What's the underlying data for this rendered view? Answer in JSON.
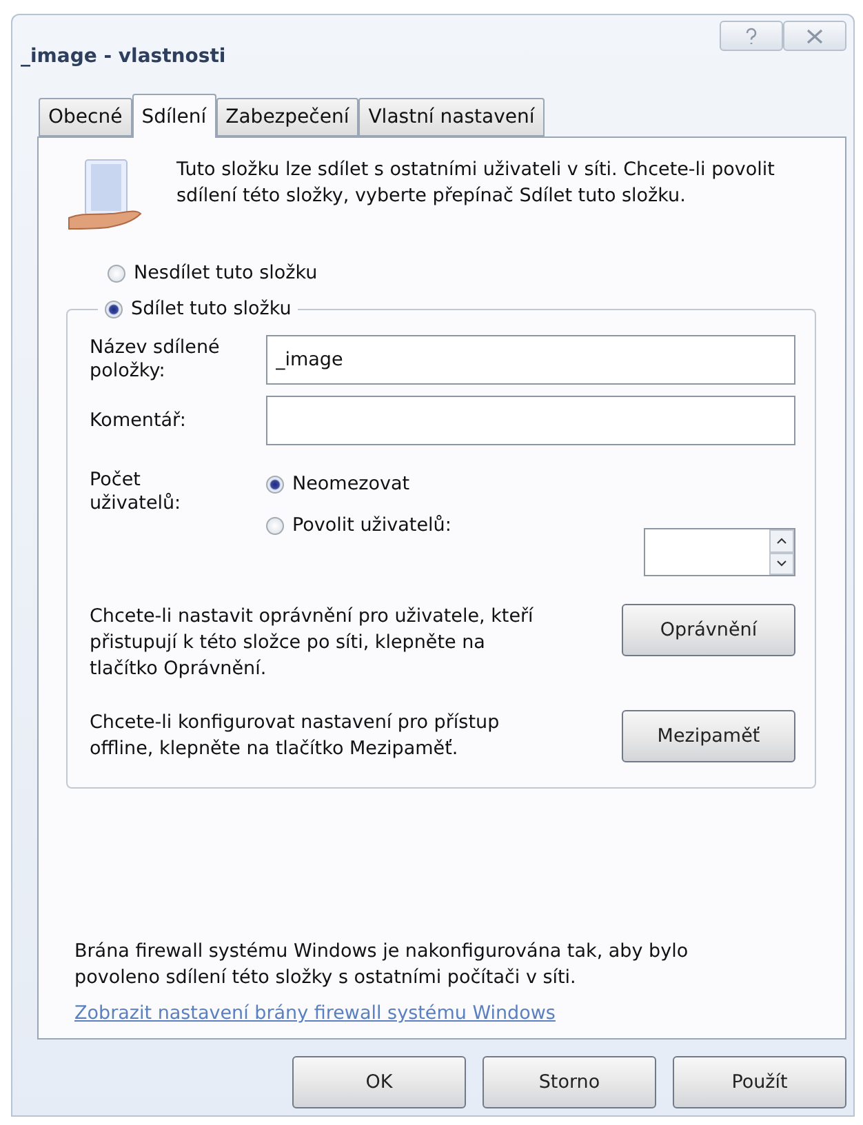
{
  "window": {
    "title": "_image - vlastnosti"
  },
  "tabs": [
    {
      "label": "Obecné",
      "selected": false
    },
    {
      "label": "Sdílení",
      "selected": true
    },
    {
      "label": "Zabezpečení",
      "selected": false
    },
    {
      "label": "Vlastní nastavení",
      "selected": false
    }
  ],
  "intro": "Tuto složku lze sdílet s ostatními uživateli v síti. Chcete-li povolit sdílení této složky, vyberte přepínač Sdílet tuto složku.",
  "share_options": [
    {
      "label": "Nesdílet tuto složku",
      "selected": false
    },
    {
      "label": "Sdílet tuto složku",
      "selected": true
    }
  ],
  "fields": [
    {
      "label": "Název sdílené položky:",
      "value": "_image"
    },
    {
      "label": "Komentář:"
    }
  ],
  "user_limit": {
    "label": "Počet uživatelů:",
    "options": [
      {
        "label": "Neomezovat",
        "selected": true
      },
      {
        "label": "Povolit uživatelů:",
        "selected": false
      }
    ]
  },
  "actions": [
    {
      "text": "Chcete-li nastavit oprávnění pro uživatele, kteří přistupují k této složce po síti, klepněte na tlačítko Oprávnění.",
      "button": "Oprávnění"
    },
    {
      "text": "Chcete-li konfigurovat nastavení pro přístup offline, klepněte na tlačítko Mezipaměť.",
      "button": "Mezipaměť"
    }
  ],
  "firewall_note": "Brána firewall systému Windows je nakonfigurována tak, aby bylo povoleno sdílení této složky s ostatními počítači v síti.",
  "firewall_link": "Zobrazit nastavení brány firewall systému Windows",
  "buttons": [
    "OK",
    "Storno",
    "Použít"
  ]
}
